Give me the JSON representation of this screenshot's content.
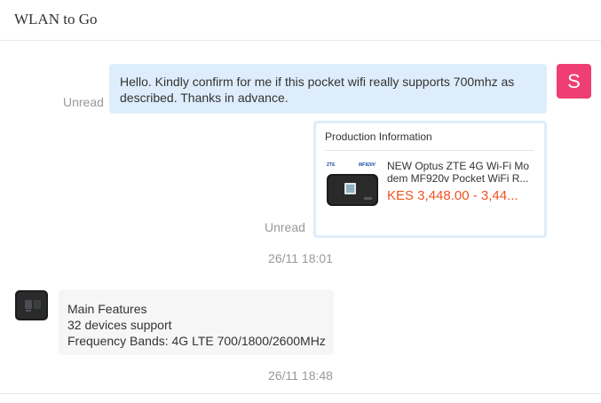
{
  "header": {
    "title": "WLAN to Go"
  },
  "messages": {
    "outgoing_text": {
      "status": "Unread",
      "text": "Hello. Kindly confirm for me if this pocket wifi really supports 700mhz as described. Thanks in advance."
    },
    "outgoing_product": {
      "status": "Unread",
      "card_title": "Production Information",
      "product_name": "NEW Optus ZTE 4G Wi-Fi Modem MF920v Pocket WiFi R...",
      "price": "KES 3,448.00 - 3,44...",
      "thumb_brand": "ZTE",
      "thumb_model": "MF920V"
    },
    "timestamp_1": "26/11 18:01",
    "incoming": {
      "lines": [
        "Main Features",
        "32 devices support",
        "Frequency Bands: 4G LTE 700/1800/2600MHz"
      ]
    },
    "timestamp_2": "26/11 18:48"
  },
  "user_avatar": {
    "initial": "S",
    "color": "#ef3e72"
  },
  "colors": {
    "outgoing_bubble": "#deedfb",
    "incoming_bubble": "#f6f6f6",
    "price": "#f2531f"
  }
}
